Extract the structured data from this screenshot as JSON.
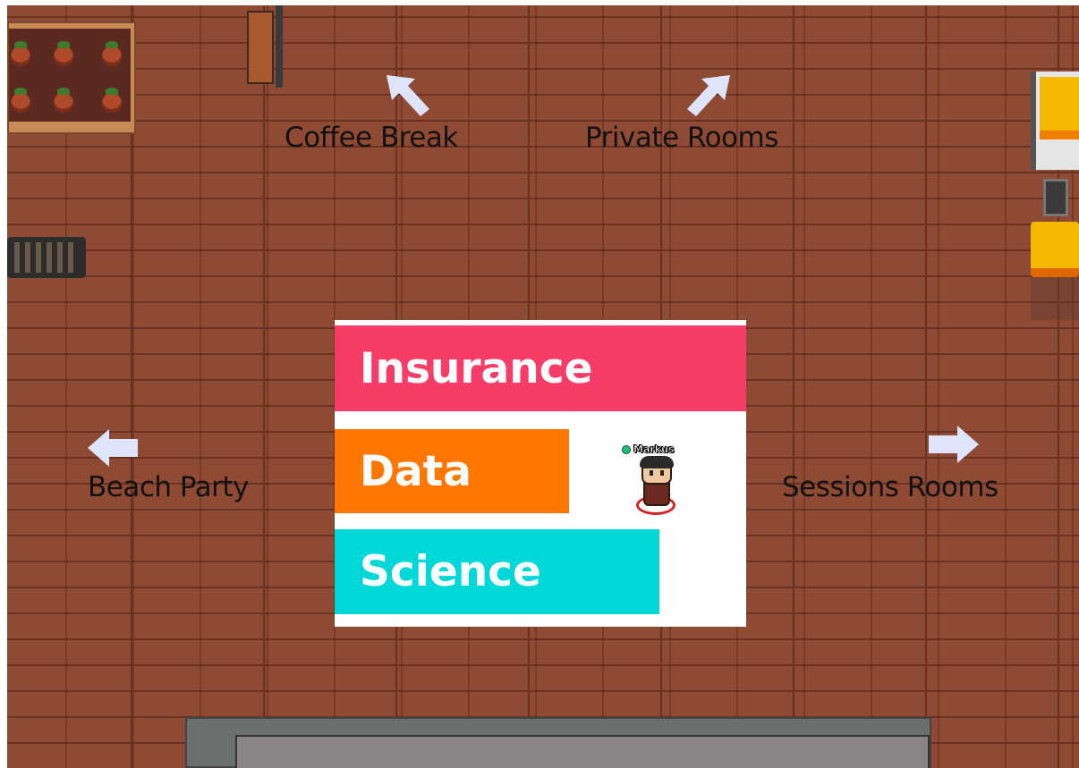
{
  "scene": {
    "signs": {
      "coffee_break": "Coffee Break",
      "private_rooms": "Private Rooms",
      "beach_party": "Beach Party",
      "sessions_rooms": "Sessions Rooms"
    },
    "board": {
      "line1": "Insurance",
      "line2": "Data",
      "line3": "Science",
      "colors": {
        "insurance": "#f73c67",
        "data": "#ff7600",
        "science": "#00d7d9"
      }
    },
    "player": {
      "name": "Markus",
      "status": "online",
      "status_color": "#1fbf75"
    },
    "arrow_color": "#dde4fb",
    "floor_color": "#8f4a33"
  }
}
